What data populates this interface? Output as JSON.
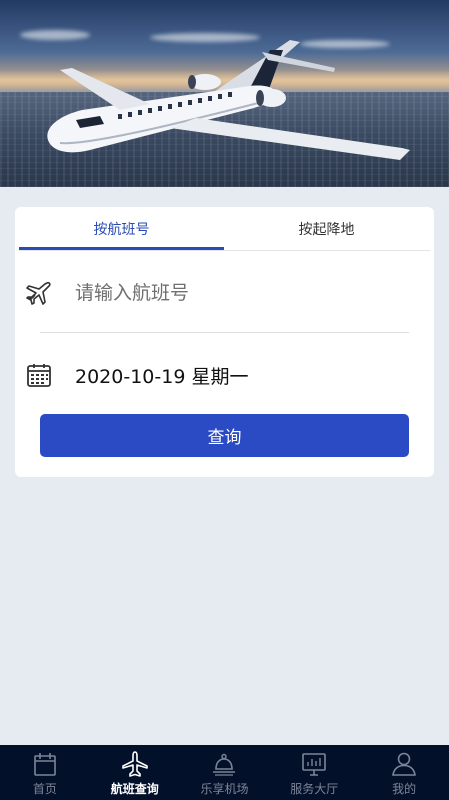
{
  "tabs": {
    "by_flight_number": "按航班号",
    "by_route": "按起降地",
    "active": "by_flight_number"
  },
  "flight_input": {
    "placeholder": "请输入航班号",
    "value": ""
  },
  "date": {
    "value": "2020-10-19 星期一"
  },
  "query_button": {
    "label": "查询"
  },
  "bottom_nav": {
    "items": [
      {
        "label": "首页",
        "icon": "home-icon"
      },
      {
        "label": "航班查询",
        "icon": "airplane-icon",
        "active": true
      },
      {
        "label": "乐享机场",
        "icon": "concierge-icon"
      },
      {
        "label": "服务大厅",
        "icon": "monitor-icon"
      },
      {
        "label": "我的",
        "icon": "user-icon"
      }
    ]
  },
  "colors": {
    "accent": "#2a4bb4",
    "button": "#2a4bc3",
    "nav_background": "#03102a",
    "page_background": "#e6eaf1"
  }
}
